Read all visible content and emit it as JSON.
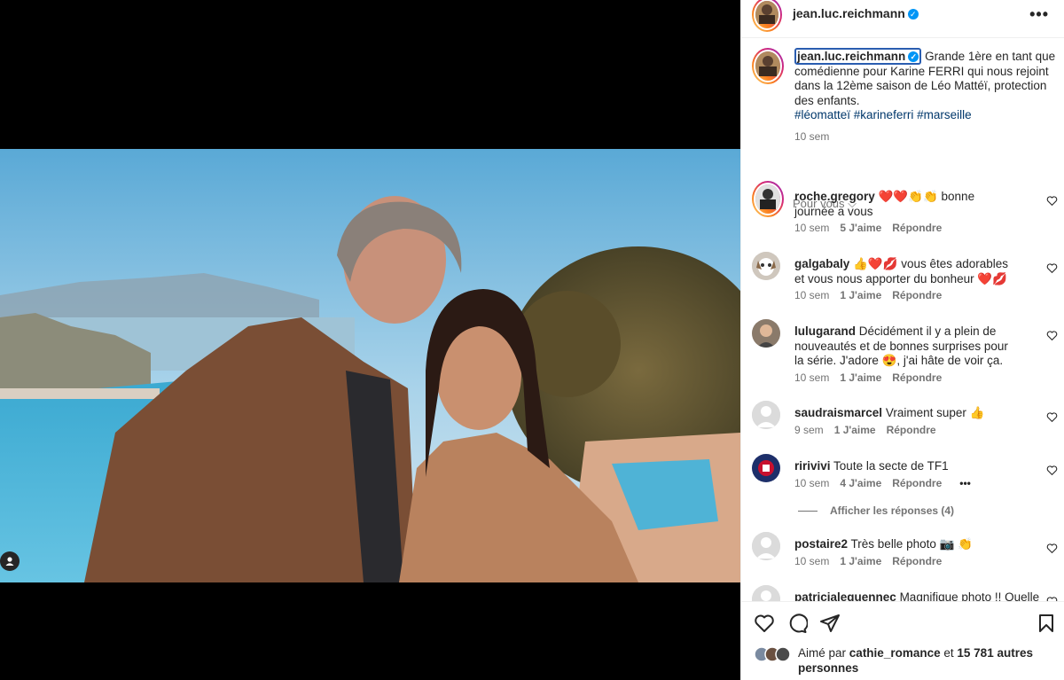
{
  "post": {
    "username": "jean.luc.reichmann",
    "caption_text": "Grande 1ère en tant que comédienne pour Karine FERRI qui nous rejoint dans la 12ème saison de Léo Mattéï, protection des enfants.",
    "hashtags": "#léomatteï #karineferri #marseille",
    "time": "10 sem",
    "more_glyph": "•••"
  },
  "section_label": "Pour vous",
  "comments": [
    {
      "username": "roche.gregory",
      "text": "❤️❤️👏👏 bonne journée a vous",
      "time": "10 sem",
      "likes": "5 J'aime",
      "reply": "Répondre"
    },
    {
      "username": "galgabaly",
      "text": "👍❤️💋 vous êtes adorables et vous nous apporter du bonheur ❤️💋",
      "time": "10 sem",
      "likes": "1 J'aime",
      "reply": "Répondre"
    },
    {
      "username": "lulugarand",
      "text": "Décidément il y a plein de nouveautés et de bonnes surprises pour la série. J'adore 😍, j'ai hâte de voir ça.",
      "time": "10 sem",
      "likes": "1 J'aime",
      "reply": "Répondre"
    },
    {
      "username": "saudraismarcel",
      "text": "Vraiment super 👍",
      "time": "9 sem",
      "likes": "1 J'aime",
      "reply": "Répondre"
    },
    {
      "username": "ririvivi",
      "text": "Toute la secte de TF1",
      "time": "10 sem",
      "likes": "4 J'aime",
      "reply": "Répondre",
      "more": "•••"
    },
    {
      "username": "postaire2",
      "text": "Très belle photo 📷 👏",
      "time": "10 sem",
      "likes": "1 J'aime",
      "reply": "Répondre"
    },
    {
      "username": "patricialeguennec",
      "text": "Magnifique photo !! Quelle",
      "time": "",
      "likes": "",
      "reply": ""
    }
  ],
  "view_replies": "Afficher les réponses (4)",
  "likes_line": {
    "prefix": "Aimé par",
    "user": "cathie_romance",
    "middle": "et",
    "count": "15 781 autres personnes"
  },
  "icons": [
    "heart-icon",
    "comment-icon",
    "share-icon",
    "bookmark-icon",
    "tag-user-icon",
    "verified-icon",
    "chevron-down-icon"
  ],
  "colors": {
    "link": "#00376b",
    "secondary": "#737373",
    "verified": "#0095f6"
  }
}
